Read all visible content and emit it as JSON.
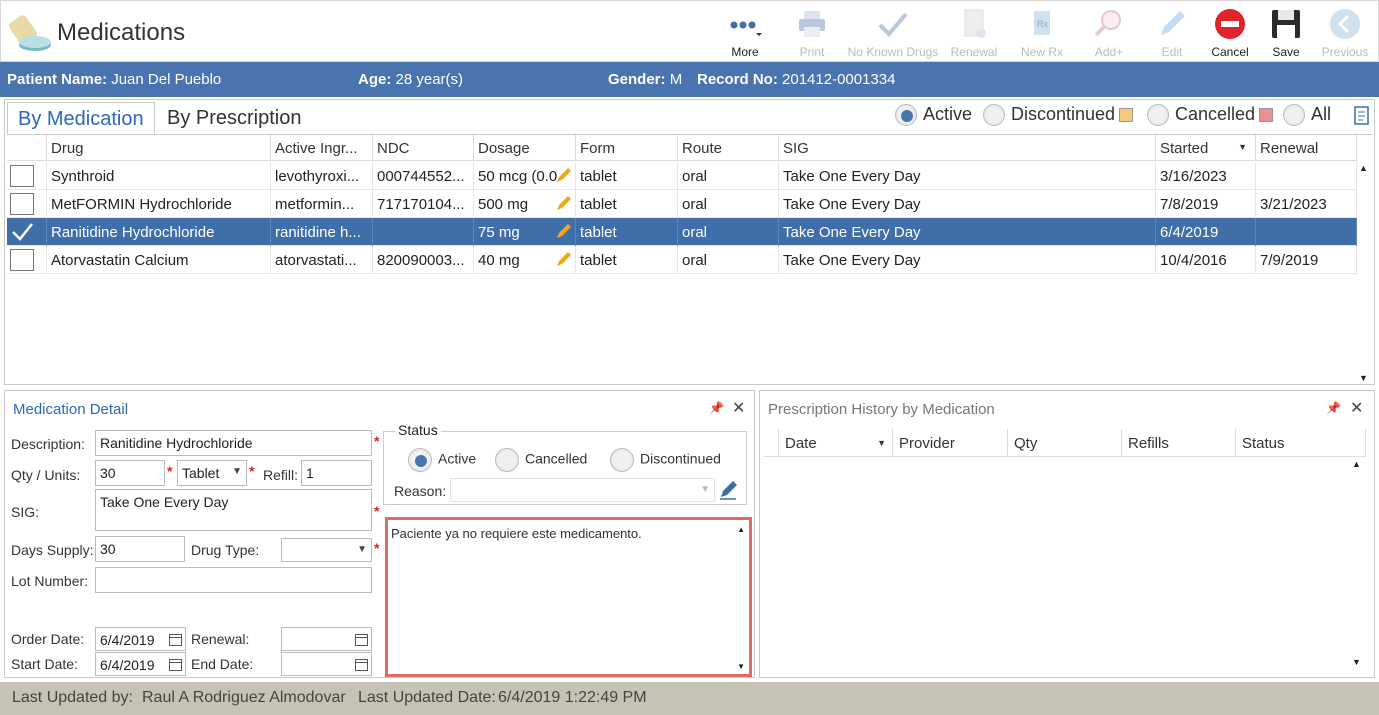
{
  "app": {
    "title": "Medications",
    "icon": "pill-bottle-icon"
  },
  "toolbar": [
    {
      "label": "More",
      "icon": "more-dots-icon",
      "enabled": true
    },
    {
      "label": "Print",
      "icon": "printer-icon",
      "enabled": false
    },
    {
      "label": "No Known Drugs",
      "icon": "checkmark-icon",
      "enabled": false
    },
    {
      "label": "Renewal",
      "icon": "renewal-icon",
      "enabled": false
    },
    {
      "label": "New Rx",
      "icon": "new-rx-icon",
      "enabled": false
    },
    {
      "label": "Add+",
      "icon": "add-search-icon",
      "enabled": false
    },
    {
      "label": "Edit",
      "icon": "pencil-icon",
      "enabled": false
    },
    {
      "label": "Cancel",
      "icon": "cancel-icon",
      "enabled": true
    },
    {
      "label": "Save",
      "icon": "save-icon",
      "enabled": true
    },
    {
      "label": "Previous",
      "icon": "back-arrow-icon",
      "enabled": false
    }
  ],
  "patient": {
    "name_label": "Patient Name:",
    "name": "Juan Del Pueblo",
    "age_label": "Age:",
    "age": "28 year(s)",
    "gender_label": "Gender:",
    "gender": "M",
    "record_label": "Record No:",
    "record": "201412-0001334"
  },
  "tabs": {
    "by_medication": "By Medication",
    "by_prescription": "By Prescription"
  },
  "filters": {
    "active": "Active",
    "discontinued": "Discontinued",
    "cancelled": "Cancelled",
    "all": "All",
    "selected": "Active"
  },
  "colors": {
    "header_blue": "#4a74b0",
    "selected_row": "#3f6ea9",
    "discontinued_swatch": "#f7c97a",
    "cancelled_swatch": "#ef8f8f",
    "note_border": "#e06b63",
    "cancel_red": "#e0252a"
  },
  "grid": {
    "columns": [
      "Drug",
      "Active Ingr...",
      "NDC",
      "Dosage",
      "Form",
      "Route",
      "SIG",
      "Started",
      "Renewal"
    ],
    "rows": [
      {
        "checked": false,
        "selected": false,
        "drug": "Synthroid",
        "ingredient": "levothyroxi...",
        "ndc": "000744552...",
        "dosage": "50 mcg (0.0",
        "form": "tablet",
        "route": "oral",
        "sig": "Take One Every Day",
        "started": "3/16/2023",
        "renewal": ""
      },
      {
        "checked": false,
        "selected": false,
        "drug": "MetFORMIN Hydrochloride",
        "ingredient": "metformin...",
        "ndc": "717170104...",
        "dosage": "500 mg",
        "form": "tablet",
        "route": "oral",
        "sig": "Take One Every Day",
        "started": "7/8/2019",
        "renewal": "3/21/2023"
      },
      {
        "checked": true,
        "selected": true,
        "drug": "Ranitidine Hydrochloride",
        "ingredient": "ranitidine h...",
        "ndc": "",
        "dosage": "75 mg",
        "form": "tablet",
        "route": "oral",
        "sig": "Take One Every Day",
        "started": "6/4/2019",
        "renewal": ""
      },
      {
        "checked": false,
        "selected": false,
        "drug": "Atorvastatin Calcium",
        "ingredient": "atorvastati...",
        "ndc": "820090003...",
        "dosage": "40 mg",
        "form": "tablet",
        "route": "oral",
        "sig": "Take One Every Day",
        "started": "10/4/2016",
        "renewal": "7/9/2019"
      }
    ]
  },
  "detail": {
    "title": "Medication Detail",
    "description_label": "Description:",
    "description": "Ranitidine Hydrochloride",
    "qty_label": "Qty / Units:",
    "qty": "30",
    "units": "Tablet",
    "refill_label": "Refill:",
    "refill": "1",
    "sig_label": "SIG:",
    "sig": "Take One Every Day",
    "days_label": "Days Supply:",
    "days": "30",
    "drugtype_label": "Drug Type:",
    "drugtype": "",
    "lot_label": "Lot Number:",
    "lot": "",
    "order_label": "Order Date:",
    "order_date": "6/4/2019",
    "renewal_label": "Renewal:",
    "renewal": "",
    "start_label": "Start Date:",
    "start_date": "6/4/2019",
    "end_label": "End Date:",
    "end_date": "",
    "status_label": "Status",
    "status_options": [
      "Active",
      "Cancelled",
      "Discontinued"
    ],
    "status_selected": "Active",
    "reason_label": "Reason:",
    "reason": "",
    "note": "Paciente ya no requiere este medicamento."
  },
  "history": {
    "title": "Prescription History by Medication",
    "columns": [
      "Date",
      "Provider",
      "Qty",
      "Refills",
      "Status"
    ]
  },
  "footer": {
    "updated_by_label": "Last Updated by:",
    "updated_by": "Raul A Rodriguez Almodovar",
    "updated_date_label": "Last Updated Date:",
    "updated_date": "6/4/2019 1:22:49 PM"
  }
}
